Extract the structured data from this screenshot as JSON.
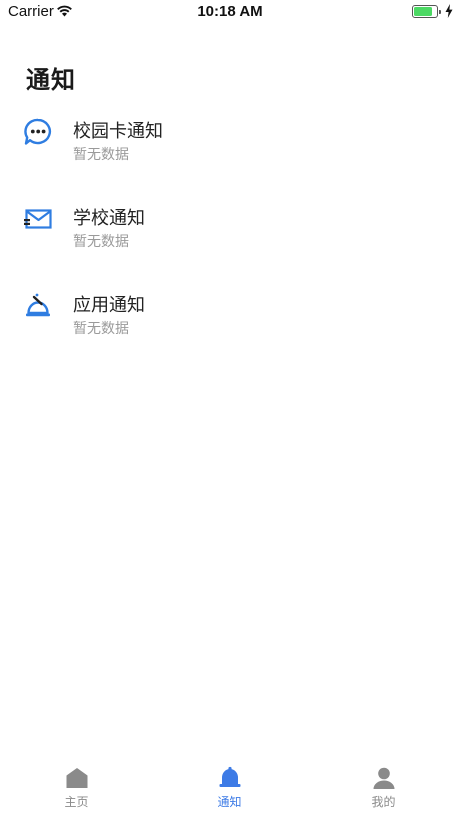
{
  "status_bar": {
    "carrier": "Carrier",
    "time": "10:18 AM",
    "battery_level": 0.85
  },
  "page": {
    "title": "通知"
  },
  "notices": [
    {
      "icon": "chat-bubble-icon",
      "title": "校园卡通知",
      "subtitle": "暂无数据"
    },
    {
      "icon": "envelope-icon",
      "title": "学校通知",
      "subtitle": "暂无数据"
    },
    {
      "icon": "bell-alarm-icon",
      "title": "应用通知",
      "subtitle": "暂无数据"
    }
  ],
  "tab_bar": {
    "tabs": [
      {
        "icon": "home-icon",
        "label": "主页",
        "active": false
      },
      {
        "icon": "bell-icon",
        "label": "通知",
        "active": true
      },
      {
        "icon": "person-icon",
        "label": "我的",
        "active": false
      }
    ]
  },
  "colors": {
    "accent": "#3d7be6",
    "icon_blue": "#2f7de1",
    "inactive": "#8a8a8a",
    "battery": "#4cd964"
  }
}
